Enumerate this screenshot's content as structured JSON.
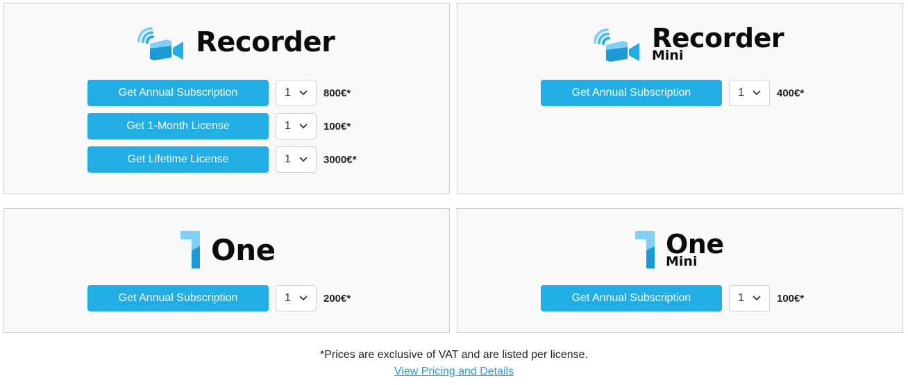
{
  "products": {
    "recorder": {
      "name": "Recorder",
      "sub": "",
      "rows": [
        {
          "button": "Get Annual Subscription",
          "qty": "1",
          "price": "800€*"
        },
        {
          "button": "Get 1-Month License",
          "qty": "1",
          "price": "100€*"
        },
        {
          "button": "Get Lifetime License",
          "qty": "1",
          "price": "3000€*"
        }
      ]
    },
    "recorder_mini": {
      "name": "Recorder",
      "sub": "Mini",
      "rows": [
        {
          "button": "Get Annual Subscription",
          "qty": "1",
          "price": "400€*"
        }
      ]
    },
    "one": {
      "name": "One",
      "sub": "",
      "rows": [
        {
          "button": "Get Annual Subscription",
          "qty": "1",
          "price": "200€*"
        }
      ]
    },
    "one_mini": {
      "name": "One",
      "sub": "Mini",
      "rows": [
        {
          "button": "Get Annual Subscription",
          "qty": "1",
          "price": "100€*"
        }
      ]
    }
  },
  "footer": {
    "note": "*Prices are exclusive of VAT and are listed per license.",
    "link": "View Pricing and Details"
  },
  "icons": {
    "recorder_logo": "camera-wifi-icon",
    "one_logo": "numeral-one-icon",
    "dropdown": "chevron-down-icon"
  },
  "colors": {
    "button": "#22ade4",
    "logo_light": "#7fd0f2",
    "logo_dark": "#1b9ad6",
    "card_bg": "#f9f9f9",
    "link": "#22a0d8"
  }
}
